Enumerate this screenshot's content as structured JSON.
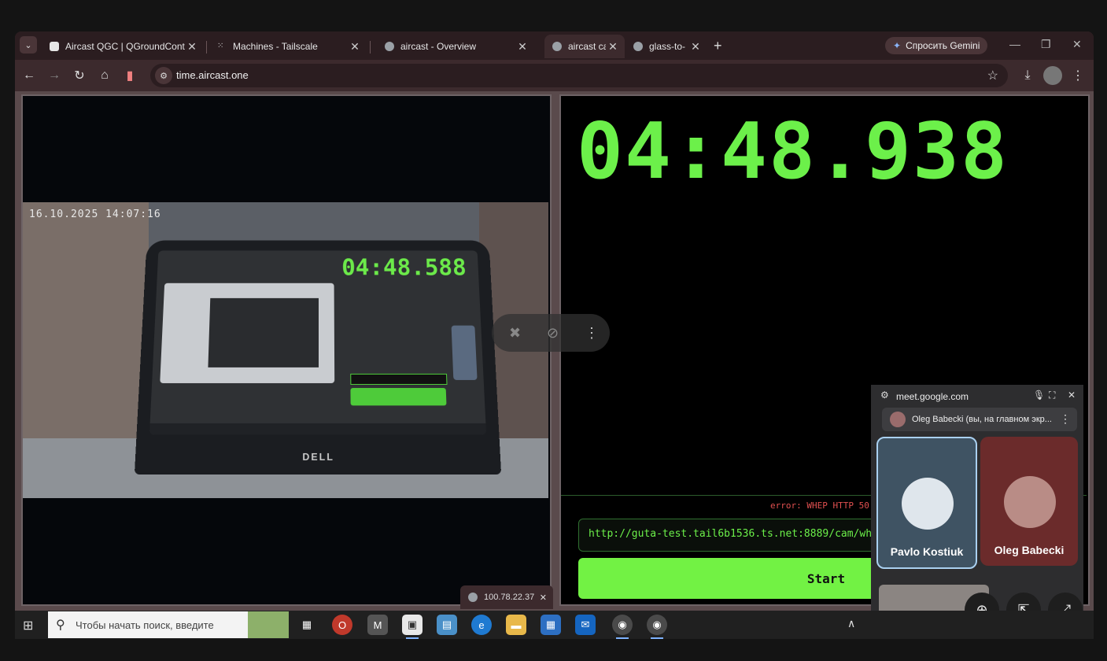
{
  "browser": {
    "tabs": [
      {
        "title": "Aircast QGC | QGroundControl",
        "icon": "document-icon",
        "color": "#e6e6e6"
      },
      {
        "title": "Machines - Tailscale",
        "icon": "tailscale-icon",
        "color": "#e6e6e6"
      },
      {
        "title": "aircast - Overview",
        "icon": "globe-icon",
        "color": "#9aa0a6"
      },
      {
        "title": "aircast ca",
        "icon": "globe-icon",
        "color": "#9aa0a6"
      },
      {
        "title": "glass-to-",
        "icon": "globe-icon",
        "color": "#9aa0a6"
      }
    ],
    "gemini_label": "Спросить Gemini",
    "url": "time.aircast.one"
  },
  "left_pane": {
    "osd_timestamp": "16.10.2025 14:07:16",
    "screen_clock": "04:48.588",
    "brand": "DELL"
  },
  "right_pane": {
    "clock": "04:48.938",
    "error": "error: WHEP HTTP 50",
    "url_value": "http://guta-test.tail6b1536.ts.net:8889/cam/whep",
    "start_label": "Start"
  },
  "popup_tab": {
    "title": "100.78.22.37"
  },
  "meet": {
    "domain": "meet.google.com",
    "pinned_text": "Oleg Babecki (вы, на главном экр...",
    "participants": [
      {
        "name": "Pavlo Kostiuk",
        "color": "#3f5363"
      },
      {
        "name": "Oleg Babecki",
        "color": "#6b2b2b"
      }
    ]
  },
  "taskbar": {
    "search_placeholder": "Чтобы начать поиск, введите"
  },
  "colors": {
    "clock_green": "#6cf04a",
    "error_red": "#e05050",
    "frame": "#3c2a2d"
  }
}
